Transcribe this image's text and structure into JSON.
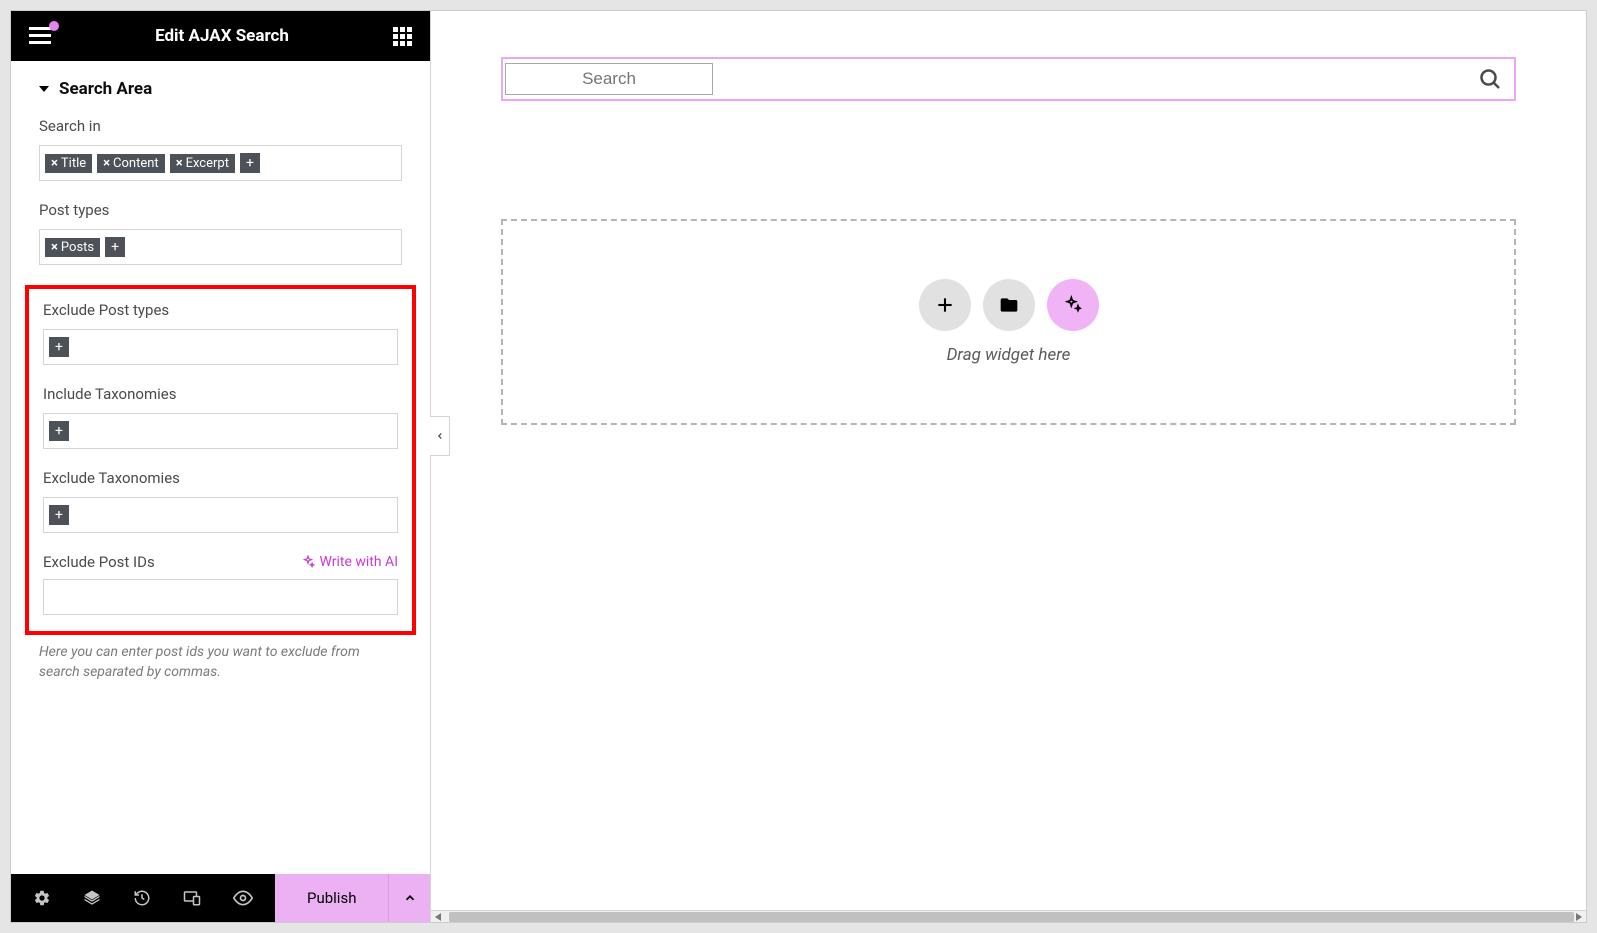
{
  "topbar": {
    "title": "Edit AJAX Search"
  },
  "section": {
    "title": "Search Area"
  },
  "labels": {
    "search_in": "Search in",
    "post_types": "Post types",
    "exclude_post_types": "Exclude Post types",
    "include_taxonomies": "Include Taxonomies",
    "exclude_taxonomies": "Exclude Taxonomies",
    "exclude_post_ids": "Exclude Post IDs",
    "write_with_ai": "Write with AI",
    "hint": "Here you can enter post ids you want to exclude from search separated by commas."
  },
  "chips": {
    "search_in": [
      "Title",
      "Content",
      "Excerpt"
    ],
    "post_types": [
      "Posts"
    ]
  },
  "preview": {
    "search_placeholder": "Search",
    "drop_label": "Drag widget here"
  },
  "actions": {
    "publish": "Publish"
  }
}
